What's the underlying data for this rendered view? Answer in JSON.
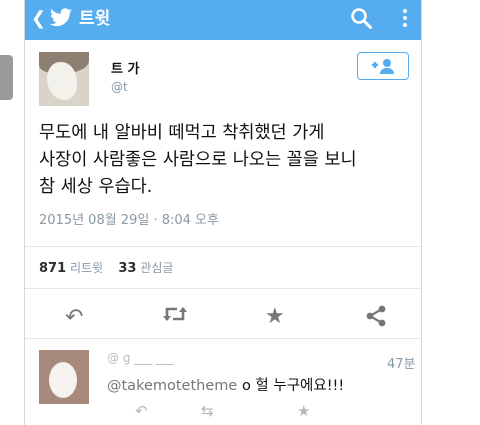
{
  "topbar": {
    "title": "트윗",
    "back_icon": "back-arrow-icon",
    "bird_icon": "twitter-bird-icon",
    "search_icon": "search-icon",
    "menu_icon": "overflow-menu-icon",
    "color": "#55acee"
  },
  "tweet": {
    "author_name": "트 가",
    "author_handle": "@t",
    "text": "무도에 내 알바비 떼먹고 착취했던 가게\n사장이 사람좋은 사람으로 나오는 꼴을 보니\n참 세상 우습다.",
    "timestamp": "2015년 08월 29일 · 8:04 오후",
    "retweet_count": "871",
    "retweet_label": "리트윗",
    "favorite_count": "33",
    "favorite_label": "관심글",
    "follow_icon": "follow-user-icon"
  },
  "actions": {
    "reply_icon": "reply-icon",
    "retweet_icon": "retweet-icon",
    "favorite_icon": "star-icon",
    "share_icon": "share-icon"
  },
  "reply": {
    "header": "@ g  ___  ___",
    "time": "47분",
    "mention": "@takemotetheme",
    "text": "o 헐 누구에요!!!"
  }
}
